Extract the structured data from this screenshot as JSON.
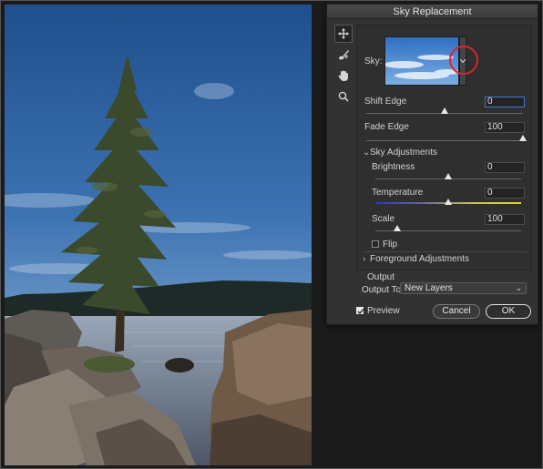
{
  "dialog": {
    "title": "Sky Replacement",
    "sky_label": "Sky:",
    "shift_edge": {
      "label": "Shift Edge",
      "value": "0",
      "level": 0.5
    },
    "fade_edge": {
      "label": "Fade Edge",
      "value": "100",
      "level": 1.0
    },
    "sky_adjustments_label": "Sky Adjustments",
    "brightness": {
      "label": "Brightness",
      "value": "0",
      "level": 0.5
    },
    "temperature": {
      "label": "Temperature",
      "value": "0",
      "level": 0.5
    },
    "scale": {
      "label": "Scale",
      "value": "100",
      "level": 0.15
    },
    "flip_label": "Flip",
    "flip_checked": false,
    "foreground_adjustments_label": "Foreground Adjustments",
    "output_title": "Output",
    "output_to_label": "Output To:",
    "output_to_value": "New Layers",
    "preview_label": "Preview",
    "preview_checked": true,
    "cancel_label": "Cancel",
    "ok_label": "OK"
  },
  "tools": [
    "move-icon",
    "sky-brush-icon",
    "hand-icon",
    "zoom-icon"
  ],
  "colors": {
    "dialog_bg": "#323232",
    "highlight_ring": "#d9242b",
    "focus_blue": "#3d7bd5",
    "temp_cool": "#2a33c7",
    "temp_warm": "#e8d620"
  }
}
